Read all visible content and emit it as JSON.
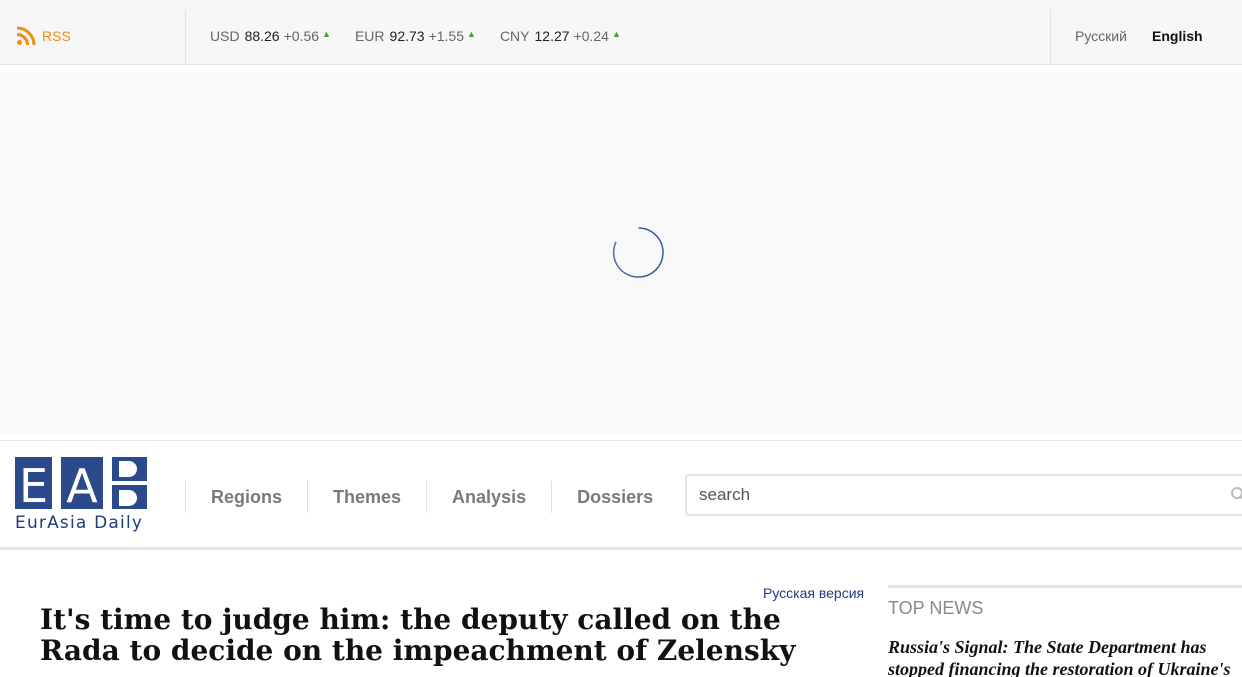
{
  "topbar": {
    "rss_label": "RSS",
    "rates": [
      {
        "currency": "USD",
        "value": "88.26",
        "change": "+0.56",
        "trend_icon": "triangle-up-icon"
      },
      {
        "currency": "EUR",
        "value": "92.73",
        "change": "+1.55",
        "trend_icon": "triangle-up-icon"
      },
      {
        "currency": "CNY",
        "value": "12.27",
        "change": "+0.24",
        "trend_icon": "triangle-up-icon"
      }
    ],
    "languages": [
      {
        "label": "Русский",
        "active": false
      },
      {
        "label": "English",
        "active": true
      }
    ]
  },
  "banner": {
    "state": "loading",
    "icon": "loading-spinner-icon"
  },
  "header": {
    "logo": {
      "letters": "EAD",
      "subtitle": "EurAsia Daily"
    },
    "nav": [
      {
        "label": "Regions"
      },
      {
        "label": "Themes"
      },
      {
        "label": "Analysis"
      },
      {
        "label": "Dossiers"
      }
    ],
    "search": {
      "placeholder": "search",
      "value": ""
    }
  },
  "article": {
    "alt_version_link": "Русская версия",
    "headline": "It's time to judge him: the deputy called on the Rada to decide on the impeachment of Zelensky"
  },
  "sidebar": {
    "top_news_title": "TOP NEWS",
    "items": [
      {
        "title": "Russia's Signal: The State Department has stopped financing the restoration of Ukraine's"
      }
    ]
  },
  "colors": {
    "accent": "#1f3c7a",
    "rss": "#f08c16",
    "up": "#3aa53a",
    "logo_blue": "#2a4a8c"
  }
}
